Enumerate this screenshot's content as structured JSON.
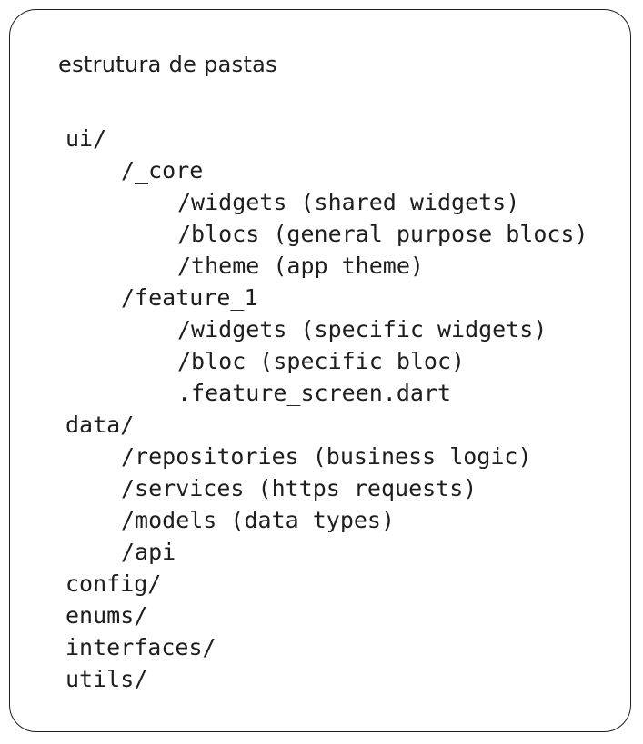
{
  "title": "estrutura de pastas",
  "tree": [
    {
      "text": "ui/",
      "level": 0
    },
    {
      "text": "/_core",
      "level": 1
    },
    {
      "text": "/widgets (shared widgets)",
      "level": 2
    },
    {
      "text": "/blocs (general purpose blocs)",
      "level": 2
    },
    {
      "text": "/theme (app theme)",
      "level": 2
    },
    {
      "text": "/feature_1",
      "level": 1
    },
    {
      "text": "/widgets (specific widgets)",
      "level": 2
    },
    {
      "text": "/bloc (specific bloc)",
      "level": 2
    },
    {
      "text": ".feature_screen.dart",
      "level": 2
    },
    {
      "text": "data/",
      "level": 0
    },
    {
      "text": "/repositories (business logic)",
      "level": 1
    },
    {
      "text": "/services (https requests)",
      "level": 1
    },
    {
      "text": "/models (data types)",
      "level": 1
    },
    {
      "text": "/api",
      "level": 1
    },
    {
      "text": "config/",
      "level": 0
    },
    {
      "text": "enums/",
      "level": 0
    },
    {
      "text": "interfaces/",
      "level": 0
    },
    {
      "text": "utils/",
      "level": 0
    }
  ]
}
